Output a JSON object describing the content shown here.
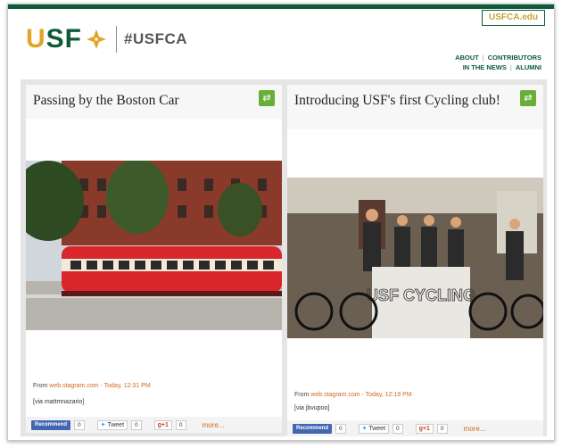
{
  "header": {
    "logo_text_u": "U",
    "logo_text_sf": "SF",
    "hashtag": "#USFCA",
    "site_link": "USFCA.edu",
    "nav": [
      "ABOUT",
      "CONTRIBUTORS",
      "IN THE NEWS",
      "ALUMNI"
    ]
  },
  "posts": [
    {
      "title": "Passing by the Boston Car",
      "from_label": "From",
      "source": "web.stagram.com",
      "time": "- Today, 12:31 PM",
      "via": "[via mattmnazario]",
      "social": {
        "recommend": "Recommend",
        "recommend_count": "0",
        "tweet": "Tweet",
        "tweet_count": "0",
        "gplus": "g+1",
        "gplus_count": "0",
        "more": "more..."
      }
    },
    {
      "title": "Introducing USF's first Cycling club!",
      "from_label": "From",
      "source": "web.stagram.com",
      "time": "- Today, 12:19 PM",
      "via": "[via jbvupoo]",
      "banner_text": "USF CYCLING",
      "social": {
        "recommend": "Recommend",
        "recommend_count": "0",
        "tweet": "Tweet",
        "tweet_count": "0",
        "gplus": "g+1",
        "gplus_count": "0",
        "more": "more..."
      }
    }
  ],
  "colors": {
    "brand_green": "#0f5a3a",
    "brand_gold": "#e0a526",
    "share_green": "#6aae3a",
    "link_orange": "#d2691e"
  },
  "icons": {
    "share": "share-icon",
    "logo_mark": "usf-logo-mark-icon",
    "facebook": "facebook-icon",
    "twitter": "twitter-icon",
    "gplus": "google-plus-icon"
  }
}
